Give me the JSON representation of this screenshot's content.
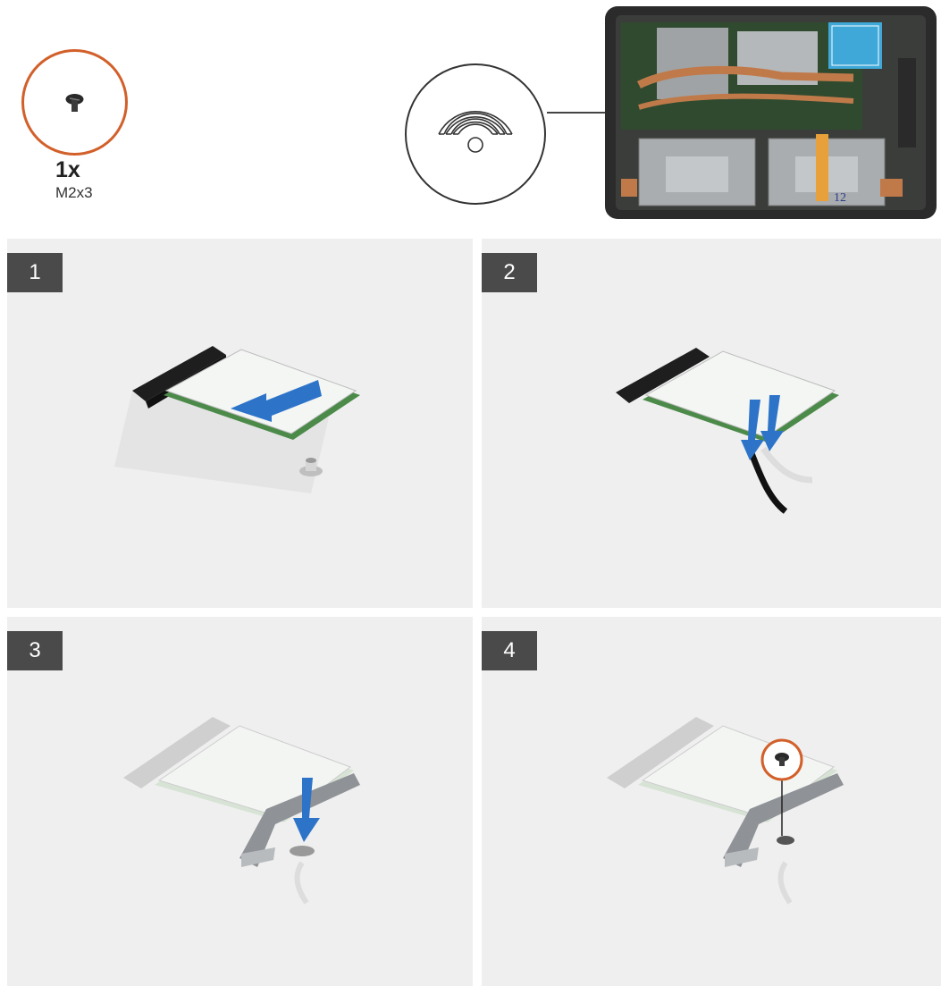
{
  "screw": {
    "quantity": "1x",
    "size": "M2x3",
    "icon": "screw-icon"
  },
  "callout": {
    "icon": "wifi-icon"
  },
  "device": {
    "handwriting": "12"
  },
  "steps": [
    {
      "number": "1"
    },
    {
      "number": "2"
    },
    {
      "number": "3"
    },
    {
      "number": "4"
    }
  ],
  "colors": {
    "accent": "#d2602a",
    "arrow": "#2d74c9",
    "badge": "#4a4a4a",
    "panel": "#efefef"
  }
}
